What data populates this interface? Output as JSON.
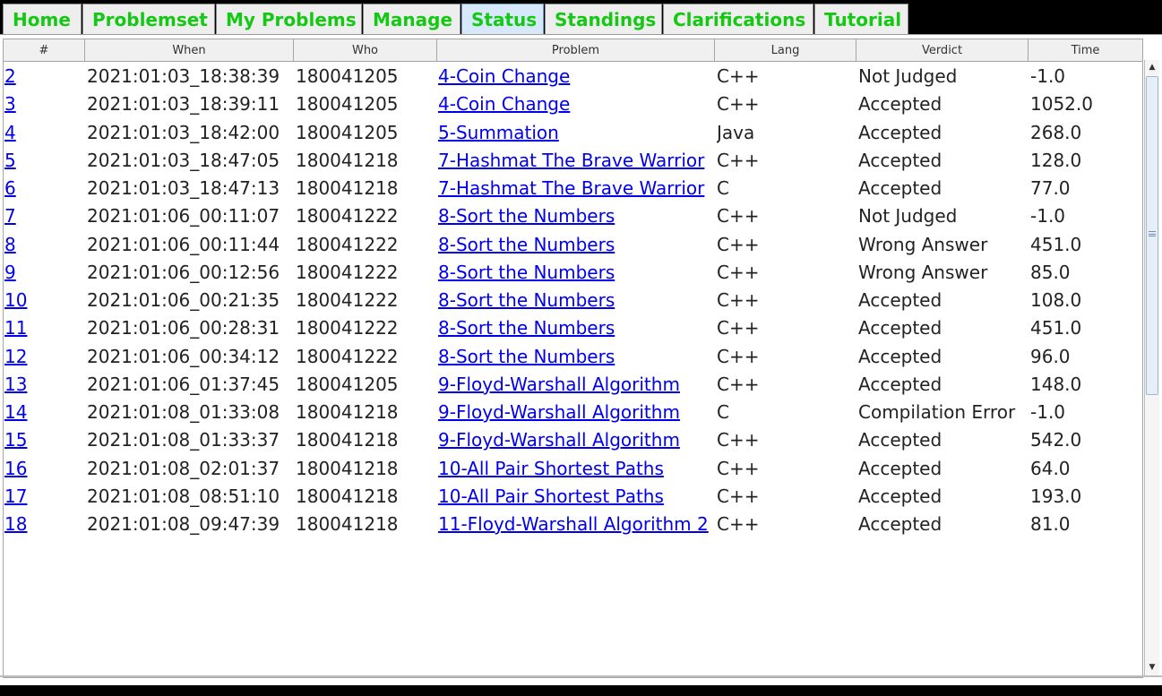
{
  "tabs": [
    {
      "label": "Home"
    },
    {
      "label": "Problemset"
    },
    {
      "label": "My Problems"
    },
    {
      "label": "Manage"
    },
    {
      "label": "Status"
    },
    {
      "label": "Standings"
    },
    {
      "label": "Clarifications"
    },
    {
      "label": "Tutorial"
    }
  ],
  "selected_tab": "Status",
  "colors": {
    "tab_text": "#14c814",
    "link": "#0000ee",
    "selected_tab_bg": "#d6e8f9"
  },
  "table": {
    "columns": [
      "#",
      "When",
      "Who",
      "Problem",
      "Lang",
      "Verdict",
      "Time"
    ],
    "rows": [
      {
        "id": "2",
        "when": "2021:01:03_18:38:39",
        "who": "180041205",
        "problem": "4-Coin Change",
        "lang": "C++",
        "verdict": "Not Judged",
        "time": "-1.0"
      },
      {
        "id": "3",
        "when": "2021:01:03_18:39:11",
        "who": "180041205",
        "problem": "4-Coin Change",
        "lang": "C++",
        "verdict": "Accepted",
        "time": "1052.0"
      },
      {
        "id": "4",
        "when": "2021:01:03_18:42:00",
        "who": "180041205",
        "problem": "5-Summation",
        "lang": "Java",
        "verdict": "Accepted",
        "time": "268.0"
      },
      {
        "id": "5",
        "when": "2021:01:03_18:47:05",
        "who": "180041218",
        "problem": "7-Hashmat The Brave Warrior",
        "lang": "C++",
        "verdict": "Accepted",
        "time": "128.0"
      },
      {
        "id": "6",
        "when": "2021:01:03_18:47:13",
        "who": "180041218",
        "problem": "7-Hashmat The Brave Warrior",
        "lang": "C",
        "verdict": "Accepted",
        "time": "77.0"
      },
      {
        "id": "7",
        "when": "2021:01:06_00:11:07",
        "who": "180041222",
        "problem": "8-Sort the Numbers",
        "lang": "C++",
        "verdict": "Not Judged",
        "time": "-1.0"
      },
      {
        "id": "8",
        "when": "2021:01:06_00:11:44",
        "who": "180041222",
        "problem": "8-Sort the Numbers",
        "lang": "C++",
        "verdict": "Wrong Answer",
        "time": "451.0"
      },
      {
        "id": "9",
        "when": "2021:01:06_00:12:56",
        "who": "180041222",
        "problem": "8-Sort the Numbers",
        "lang": "C++",
        "verdict": "Wrong Answer",
        "time": "85.0"
      },
      {
        "id": "10",
        "when": "2021:01:06_00:21:35",
        "who": "180041222",
        "problem": "8-Sort the Numbers",
        "lang": "C++",
        "verdict": "Accepted",
        "time": "108.0"
      },
      {
        "id": "11",
        "when": "2021:01:06_00:28:31",
        "who": "180041222",
        "problem": "8-Sort the Numbers",
        "lang": "C++",
        "verdict": "Accepted",
        "time": "451.0"
      },
      {
        "id": "12",
        "when": "2021:01:06_00:34:12",
        "who": "180041222",
        "problem": "8-Sort the Numbers",
        "lang": "C++",
        "verdict": "Accepted",
        "time": "96.0"
      },
      {
        "id": "13",
        "when": "2021:01:06_01:37:45",
        "who": "180041205",
        "problem": "9-Floyd-Warshall Algorithm",
        "lang": "C++",
        "verdict": "Accepted",
        "time": "148.0"
      },
      {
        "id": "14",
        "when": "2021:01:08_01:33:08",
        "who": "180041218",
        "problem": "9-Floyd-Warshall Algorithm",
        "lang": "C",
        "verdict": "Compilation Error",
        "time": "-1.0"
      },
      {
        "id": "15",
        "when": "2021:01:08_01:33:37",
        "who": "180041218",
        "problem": "9-Floyd-Warshall Algorithm",
        "lang": "C++",
        "verdict": "Accepted",
        "time": "542.0"
      },
      {
        "id": "16",
        "when": "2021:01:08_02:01:37",
        "who": "180041218",
        "problem": "10-All Pair Shortest Paths",
        "lang": "C++",
        "verdict": "Accepted",
        "time": "64.0"
      },
      {
        "id": "17",
        "when": "2021:01:08_08:51:10",
        "who": "180041218",
        "problem": "10-All Pair Shortest Paths",
        "lang": "C++",
        "verdict": "Accepted",
        "time": "193.0"
      },
      {
        "id": "18",
        "when": "2021:01:08_09:47:39",
        "who": "180041218",
        "problem": "11-Floyd-Warshall Algorithm 2",
        "lang": "C++",
        "verdict": "Accepted",
        "time": "81.0"
      }
    ]
  },
  "scrollbar": {
    "up_icon": "scroll-up-arrow",
    "down_icon": "scroll-down-arrow"
  }
}
